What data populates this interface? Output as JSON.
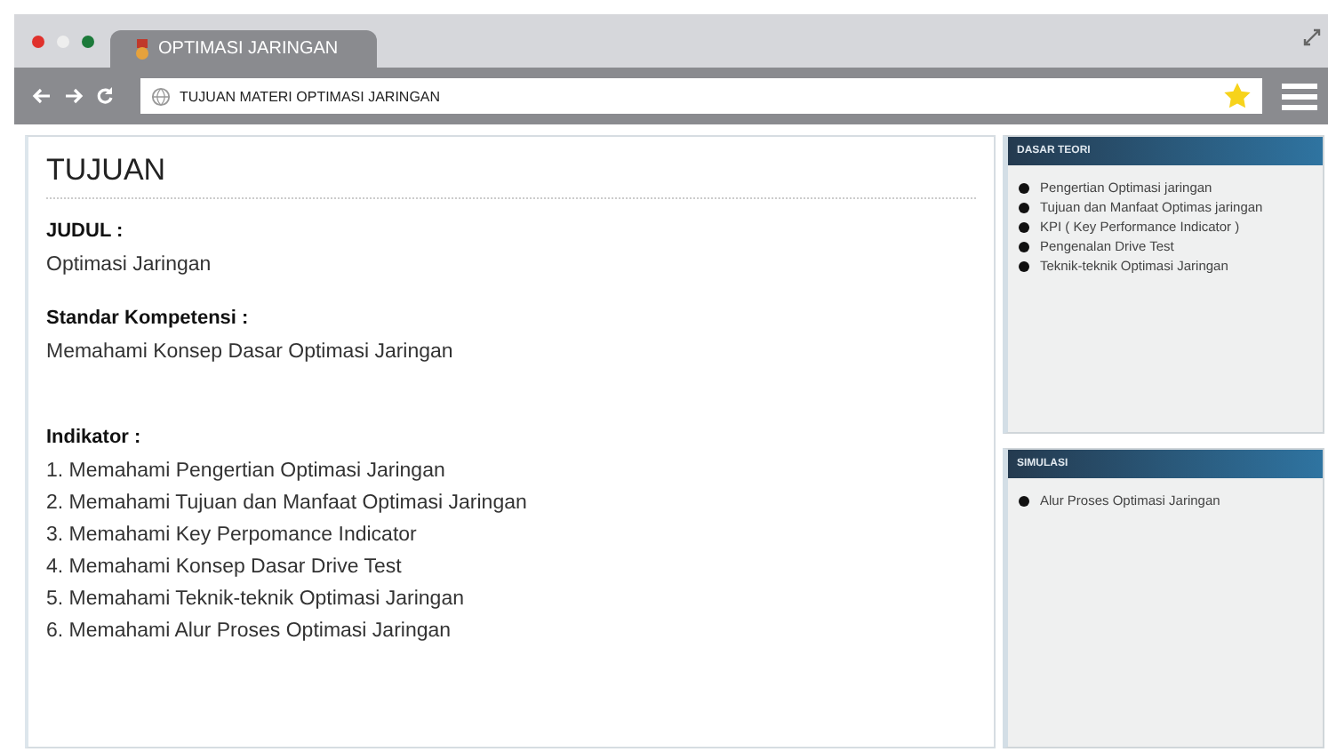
{
  "tab": {
    "title": "OPTIMASI JARINGAN"
  },
  "address": {
    "value": "TUJUAN MATERI OPTIMASI JARINGAN"
  },
  "main": {
    "heading": "TUJUAN",
    "sections": [
      {
        "label": "JUDUL :",
        "kind": "text",
        "text": "Optimasi Jaringan"
      },
      {
        "label": "Standar Kompetensi :",
        "kind": "text",
        "text": "Memahami Konsep Dasar Optimasi Jaringan"
      },
      {
        "label": "Indikator :",
        "kind": "list",
        "items": [
          "1. Memahami Pengertian Optimasi Jaringan",
          "2. Memahami Tujuan dan Manfaat Optimasi Jaringan",
          "3. Memahami Key Perpomance Indicator",
          "4. Memahami Konsep Dasar Drive Test",
          "5. Memahami Teknik-teknik Optimasi Jaringan",
          "6. Memahami Alur Proses Optimasi Jaringan"
        ]
      }
    ]
  },
  "sidebar": [
    {
      "title": "DASAR TEORI",
      "items": [
        "Pengertian Optimasi jaringan",
        "Tujuan dan Manfaat Optimas jaringan",
        "KPI ( Key Performance Indicator )",
        "Pengenalan Drive Test",
        "Teknik-teknik Optimasi Jaringan"
      ]
    },
    {
      "title": "SIMULASI",
      "items": [
        "Alur Proses Optimasi Jaringan"
      ]
    }
  ]
}
